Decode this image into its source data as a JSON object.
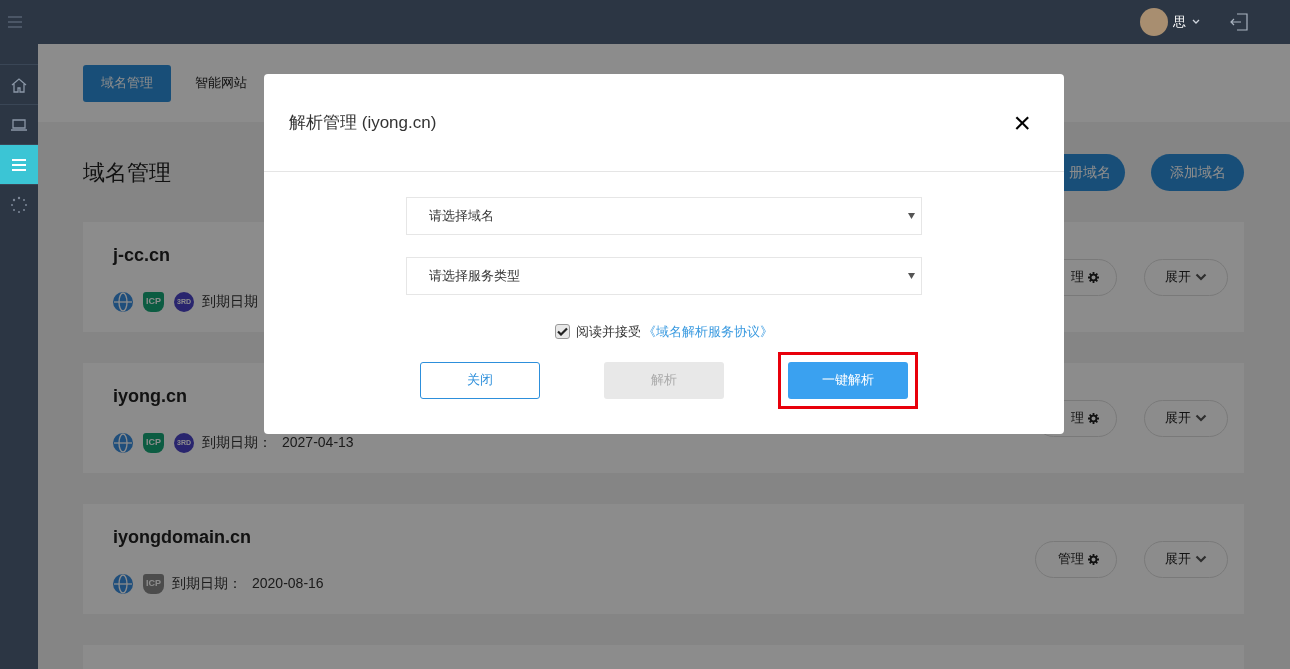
{
  "topbar": {
    "user_name": "思"
  },
  "sidebar": {
    "items": [
      {
        "kind": "home",
        "selected": false
      },
      {
        "kind": "laptop",
        "selected": false
      },
      {
        "kind": "list",
        "selected": true
      },
      {
        "kind": "spinner",
        "selected": false
      }
    ]
  },
  "tabs": [
    {
      "label": "域名管理",
      "selected": true
    },
    {
      "label": "智能网站",
      "selected": false
    }
  ],
  "page_title": "域名管理",
  "actions": [
    {
      "label": "册域名"
    },
    {
      "label": "添加域名"
    }
  ],
  "domains": [
    {
      "kind": "domain",
      "name": "j-cc.cn",
      "icp_badge": "ICP",
      "icp": true,
      "third_party_badge": "3RD",
      "expiry_label": "到期日期",
      "manage_label": "理",
      "expand_label": "展开"
    },
    {
      "kind": "domain",
      "name": "iyong.cn",
      "icp_badge": "ICP",
      "icp": true,
      "third_party_badge": "3RD",
      "expiry_label": "到期日期：",
      "expiry_date": "2027-04-13",
      "manage_label": "理",
      "expand_label": "展开"
    },
    {
      "kind": "domain",
      "name": "iyongdomain.cn",
      "icp_badge": "ICP",
      "icp": false,
      "expiry_label": "到期日期：",
      "expiry_date": "2020-08-16",
      "manage_label": "管理",
      "expand_label": "展开"
    },
    {
      "kind": "cut_off"
    }
  ],
  "modal": {
    "title": "解析管理 (iyong.cn)",
    "close": "×",
    "selects": [
      {
        "placeholder": "请选择域名"
      },
      {
        "placeholder": "请选择服务类型"
      }
    ],
    "agreement": {
      "checked": true,
      "text": "阅读并接受",
      "link": "《域名解析服务协议》"
    },
    "buttons": [
      {
        "label": "关闭",
        "kind": "outline",
        "highlighted": false
      },
      {
        "label": "解析",
        "kind": "disabled",
        "highlighted": false
      },
      {
        "label": "一键解析",
        "kind": "primary",
        "highlighted": true
      }
    ]
  }
}
